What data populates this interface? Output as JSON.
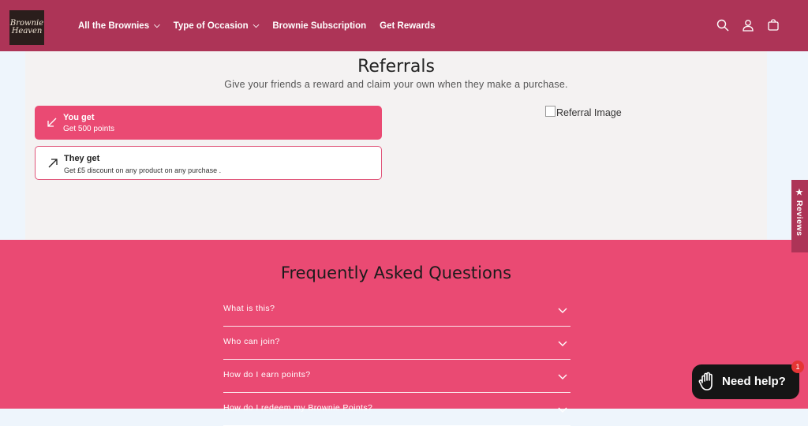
{
  "header": {
    "logo_line1": "Brownie",
    "logo_line2": "Heaven",
    "nav": [
      {
        "label": "All the Brownies",
        "has_dropdown": true
      },
      {
        "label": "Type of Occasion",
        "has_dropdown": true
      },
      {
        "label": "Brownie Subscription",
        "has_dropdown": false
      },
      {
        "label": "Get Rewards",
        "has_dropdown": false
      }
    ],
    "icons": [
      "search-icon",
      "account-icon",
      "cart-icon"
    ],
    "bg_color": "#ad3457"
  },
  "referrals": {
    "title": "Referrals",
    "subtitle": "Give your friends a reward and claim your own when they make a purchase.",
    "you_get": {
      "title": "You get",
      "desc": "Get 500 points"
    },
    "they_get": {
      "title": "They get",
      "desc": "Get £5 discount on any product on any purchase ."
    },
    "image_alt": "Referral Image",
    "accent_color": "#ea4a73"
  },
  "faq": {
    "title": "Frequently Asked Questions",
    "items": [
      "What is this?",
      "Who can join?",
      "How do I earn points?",
      "How do I redeem my Brownie Points?"
    ]
  },
  "reviews_tab": {
    "label": "★ Reviews"
  },
  "help_widget": {
    "label": "Need help?",
    "badge": "1"
  }
}
